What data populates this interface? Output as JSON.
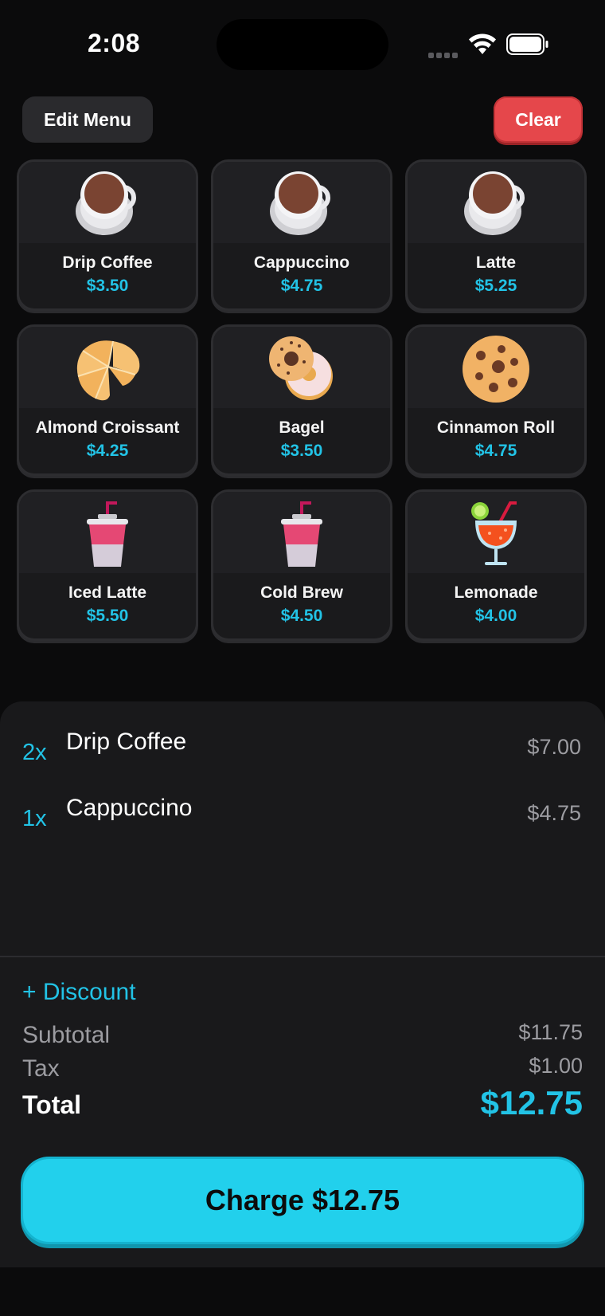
{
  "status": {
    "time": "2:08"
  },
  "toolbar": {
    "edit_label": "Edit Menu",
    "clear_label": "Clear"
  },
  "menu": [
    {
      "name": "Drip Coffee",
      "price": "$3.50",
      "icon": "coffee-cup-icon"
    },
    {
      "name": "Cappuccino",
      "price": "$4.75",
      "icon": "coffee-cup-icon"
    },
    {
      "name": "Latte",
      "price": "$5.25",
      "icon": "coffee-cup-icon"
    },
    {
      "name": "Almond Croissant",
      "price": "$4.25",
      "icon": "croissant-icon"
    },
    {
      "name": "Bagel",
      "price": "$3.50",
      "icon": "bagel-icon"
    },
    {
      "name": "Cinnamon Roll",
      "price": "$4.75",
      "icon": "cookie-icon"
    },
    {
      "name": "Iced Latte",
      "price": "$5.50",
      "icon": "iced-cup-icon"
    },
    {
      "name": "Cold Brew",
      "price": "$4.50",
      "icon": "iced-cup-icon"
    },
    {
      "name": "Lemonade",
      "price": "$4.00",
      "icon": "tropical-drink-icon"
    }
  ],
  "order": {
    "lines": [
      {
        "qty": "2x",
        "item": "Drip Coffee",
        "amount": "$7.00"
      },
      {
        "qty": "1x",
        "item": "Cappuccino",
        "amount": "$4.75"
      }
    ],
    "discount_label": "+ Discount",
    "subtotal_label": "Subtotal",
    "subtotal": "$11.75",
    "tax_label": "Tax",
    "tax": "$1.00",
    "total_label": "Total",
    "total": "$12.75",
    "charge_label": "Charge $12.75"
  },
  "colors": {
    "accent": "#22c3e6",
    "danger": "#e5474b",
    "background": "#0b0b0c",
    "panel": "#19191b"
  }
}
